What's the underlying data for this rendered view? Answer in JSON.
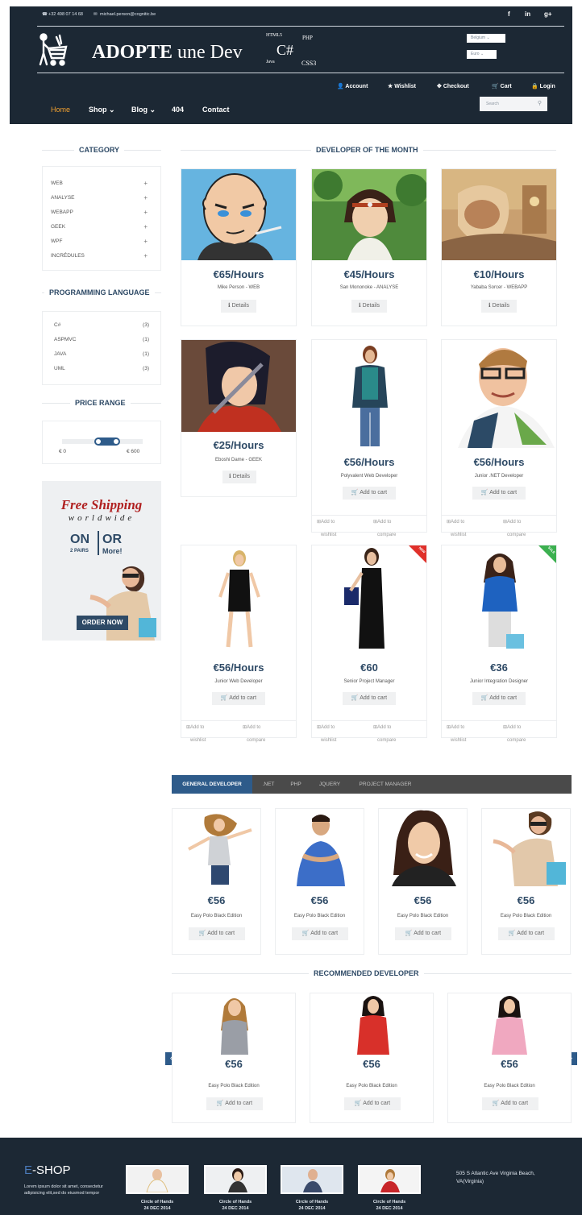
{
  "header": {
    "phone": "+32 498 07 14 68",
    "email": "michael.person@cognitic.be",
    "social": [
      "f",
      "in",
      "g+"
    ],
    "logo_bold": "ADOPTE",
    "logo_rest": "une Dev",
    "lang_words": [
      "HTML5",
      "PHP",
      "C#",
      "Java",
      "CSS3"
    ],
    "country_select": "Belgium",
    "currency_select": "Euro",
    "user_nav": [
      "Account",
      "Wishlist",
      "Checkout",
      "Cart",
      "Login"
    ],
    "main_nav": [
      "Home",
      "Shop",
      "Blog",
      "404",
      "Contact"
    ],
    "search_placeholder": "Search"
  },
  "sidebar": {
    "category_title": "CATEGORY",
    "categories": [
      "WEB",
      "ANALYSE",
      "WEBAPP",
      "GEEK",
      "WPF",
      "INCRÉDULES"
    ],
    "language_title": "PROGRAMMING LANGUAGE",
    "languages": [
      {
        "name": "C#",
        "count": "(3)"
      },
      {
        "name": "ASPMVC",
        "count": "(1)"
      },
      {
        "name": "JAVA",
        "count": "(1)"
      },
      {
        "name": "UML",
        "count": "(3)"
      }
    ],
    "price_title": "PRICE RANGE",
    "price_min": "€ 0",
    "price_max": "€ 600",
    "ad": {
      "line1": "Free Shipping",
      "line2": "worldwide",
      "on": "ON",
      "or": "OR",
      "pairs": "2 PAIRS",
      "more": "More!",
      "button": "ORDER NOW"
    }
  },
  "dotm": {
    "title": "DEVELOPER OF THE MONTH",
    "details_label": "Details",
    "cart_label": "Add to cart",
    "wishlist_label": "Add to wishlist",
    "compare_label": "Add to compare",
    "cards": [
      {
        "price": "€65/Hours",
        "name": "Mike Person - WEB"
      },
      {
        "price": "€45/Hours",
        "name": "San Mononoke - ANALYSE"
      },
      {
        "price": "€10/Hours",
        "name": "Yababa Sorcer - WEBAPP"
      },
      {
        "price": "€25/Hours",
        "name": "Eboshi Dame - GEEK"
      },
      {
        "price": "€56/Hours",
        "name": "Polyvalent Web Developer"
      },
      {
        "price": "€56/Hours",
        "name": "Junior .NET Developer"
      },
      {
        "price": "€56/Hours",
        "name": "Junior Web Developer"
      },
      {
        "price": "€60",
        "name": "Senior Project Manager",
        "badge": "NEW"
      },
      {
        "price": "€36",
        "name": "Junior Integration Designer",
        "badge": "SALE"
      }
    ]
  },
  "tabs": {
    "items": [
      "GENERAL DEVELOPER",
      ".NET",
      "PHP",
      "JQUERY",
      "PROJECT MANAGER"
    ],
    "cards": [
      {
        "price": "€56",
        "name": "Easy Polo Black Edition"
      },
      {
        "price": "€56",
        "name": "Easy Polo Black Edition"
      },
      {
        "price": "€56",
        "name": "Easy Polo Black Edition"
      },
      {
        "price": "€56",
        "name": "Easy Polo Black Edition"
      }
    ]
  },
  "recommended": {
    "title": "RECOMMENDED DEVELOPER",
    "cards": [
      {
        "price": "€56",
        "name": "Easy Polo Black Edition"
      },
      {
        "price": "€56",
        "name": "Easy Polo Black Edition"
      },
      {
        "price": "€56",
        "name": "Easy Polo Black Edition"
      }
    ]
  },
  "footer": {
    "brand_e": "E",
    "brand_rest": "-SHOP",
    "text": "Lorem ipsum dolor sit amet, consectetur adipisicing elit,sed do eiusmod tempor",
    "thumbs": [
      {
        "title": "Circle of Hands",
        "date": "24 DEC 2014"
      },
      {
        "title": "Circle of Hands",
        "date": "24 DEC 2014"
      },
      {
        "title": "Circle of Hands",
        "date": "24 DEC 2014"
      },
      {
        "title": "Circle of Hands",
        "date": "24 DEC 2014"
      }
    ],
    "address": "505 S Atlantic Ave Virginia Beach, VA(Virginia)"
  },
  "colors": {
    "header_bg": "#1c2834",
    "accent": "#2e5b8a",
    "title": "#2e4a66",
    "active_nav": "#f0a030"
  }
}
